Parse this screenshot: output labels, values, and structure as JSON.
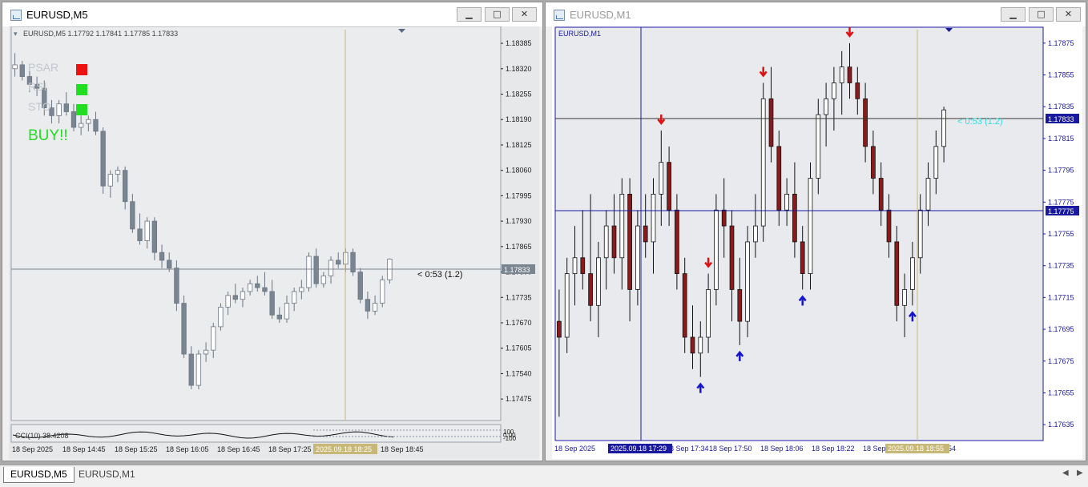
{
  "window_m5": {
    "title": "EURUSD,M5",
    "info_line": "EURUSD,M5  1.17792 1.17841 1.17785 1.17833",
    "indicator_labels": [
      "PSAR",
      "RSI",
      "STO"
    ],
    "signal_text": "BUY!!",
    "countdown": "< 0:53 (1.2)",
    "price_ticks": [
      "1.18385",
      "1.18320",
      "1.18255",
      "1.18190",
      "1.18125",
      "1.18060",
      "1.17995",
      "1.17930",
      "1.17865",
      "1.17800",
      "1.17735",
      "1.17670",
      "1.17605",
      "1.17540",
      "1.17475"
    ],
    "current_price": "1.17833",
    "time_ticks": [
      "18 Sep 2025",
      "18 Sep 14:45",
      "18 Sep 15:25",
      "18 Sep 16:05",
      "18 Sep 16:45",
      "18 Sep 17:25",
      "18 Sep 18:45"
    ],
    "cursor_time": "2025.09.18 18:25",
    "subwindow_label": "CCI(10) 38.4208",
    "subwindow_ticks": [
      "100",
      "0.00",
      "-100"
    ]
  },
  "window_m1": {
    "title": "EURUSD,M1",
    "info_line": "EURUSD,M1",
    "countdown": "< 0:53 (1.2)",
    "price_ticks": [
      "1.17875",
      "1.17855",
      "1.17835",
      "1.17815",
      "1.17795",
      "1.17775",
      "1.17755",
      "1.17735",
      "1.17715",
      "1.17695",
      "1.17675",
      "1.17655",
      "1.17635"
    ],
    "current_price": "1.17833",
    "crosshair_price": "1.17775",
    "time_ticks": [
      "18 Sep 2025",
      "18 Sep 17:34",
      "18 Sep 17:50",
      "18 Sep 18:06",
      "18 Sep 18:22",
      "18 Sep",
      "54"
    ],
    "crosshair_time": "2025.09.18 17:29",
    "cursor_time": "2025.09.18 18:55"
  },
  "window_buttons": {
    "minimize": "▁",
    "maximize": "□",
    "close": "✕"
  },
  "tabs": [
    "EURUSD,M5",
    "EURUSD,M1"
  ],
  "colors": {
    "bear_m5": "#7a8592",
    "bull_m5": "#ffffff",
    "axis_blue": "#1a1aa0",
    "buy_green": "#22dd22",
    "arrow_red": "#dd1111",
    "arrow_blue": "#1515d0",
    "cursor_tan": "#c8b878"
  },
  "chart_data": [
    {
      "type": "candlestick",
      "symbol": "EURUSD",
      "timeframe": "M5",
      "ylim": [
        1.1742,
        1.1842
      ],
      "candles": [
        [
          1.1832,
          1.1836,
          1.183,
          1.1833
        ],
        [
          1.1833,
          1.1834,
          1.1829,
          1.183
        ],
        [
          1.183,
          1.1832,
          1.1826,
          1.1828
        ],
        [
          1.1828,
          1.183,
          1.1825,
          1.1827
        ],
        [
          1.1827,
          1.1829,
          1.182,
          1.1822
        ],
        [
          1.1822,
          1.1824,
          1.1818,
          1.182
        ],
        [
          1.182,
          1.1824,
          1.1818,
          1.1823
        ],
        [
          1.1823,
          1.1826,
          1.182,
          1.1821
        ],
        [
          1.1821,
          1.1823,
          1.1816,
          1.1817
        ],
        [
          1.1817,
          1.182,
          1.1815,
          1.1818
        ],
        [
          1.1818,
          1.182,
          1.1816,
          1.1819
        ],
        [
          1.1819,
          1.1821,
          1.1815,
          1.1816
        ],
        [
          1.1816,
          1.1817,
          1.18,
          1.1802
        ],
        [
          1.1802,
          1.1806,
          1.1799,
          1.1805
        ],
        [
          1.1805,
          1.1807,
          1.1803,
          1.1806
        ],
        [
          1.1806,
          1.1807,
          1.1796,
          1.1798
        ],
        [
          1.1798,
          1.18,
          1.179,
          1.1791
        ],
        [
          1.1791,
          1.1795,
          1.1787,
          1.1788
        ],
        [
          1.1788,
          1.1794,
          1.1786,
          1.1793
        ],
        [
          1.1793,
          1.1794,
          1.1783,
          1.1785
        ],
        [
          1.1785,
          1.1787,
          1.1781,
          1.1783
        ],
        [
          1.1783,
          1.1785,
          1.178,
          1.1781
        ],
        [
          1.1781,
          1.1783,
          1.177,
          1.1772
        ],
        [
          1.1772,
          1.1774,
          1.1758,
          1.1759
        ],
        [
          1.1759,
          1.1761,
          1.175,
          1.1751
        ],
        [
          1.1751,
          1.176,
          1.175,
          1.1759
        ],
        [
          1.1759,
          1.1762,
          1.1757,
          1.176
        ],
        [
          1.176,
          1.1767,
          1.1758,
          1.1766
        ],
        [
          1.1766,
          1.1772,
          1.1765,
          1.1771
        ],
        [
          1.1771,
          1.1775,
          1.1769,
          1.1774
        ],
        [
          1.1774,
          1.1777,
          1.1772,
          1.1773
        ],
        [
          1.1773,
          1.1776,
          1.1771,
          1.1775
        ],
        [
          1.1775,
          1.1778,
          1.1774,
          1.1777
        ],
        [
          1.1777,
          1.1779,
          1.1775,
          1.1776
        ],
        [
          1.1776,
          1.178,
          1.1774,
          1.1775
        ],
        [
          1.1775,
          1.1778,
          1.1768,
          1.1769
        ],
        [
          1.1769,
          1.1771,
          1.1767,
          1.1768
        ],
        [
          1.1768,
          1.1774,
          1.1767,
          1.1772
        ],
        [
          1.1772,
          1.1776,
          1.177,
          1.1775
        ],
        [
          1.1775,
          1.1778,
          1.1773,
          1.1776
        ],
        [
          1.1776,
          1.1785,
          1.1775,
          1.1784
        ],
        [
          1.1784,
          1.1786,
          1.1776,
          1.1777
        ],
        [
          1.1777,
          1.178,
          1.1776,
          1.1779
        ],
        [
          1.1779,
          1.1784,
          1.1777,
          1.1783
        ],
        [
          1.1783,
          1.1785,
          1.1781,
          1.1782
        ],
        [
          1.1782,
          1.1786,
          1.178,
          1.1785
        ],
        [
          1.1785,
          1.1786,
          1.1779,
          1.178
        ],
        [
          1.178,
          1.1781,
          1.1772,
          1.1773
        ],
        [
          1.1773,
          1.1775,
          1.1768,
          1.177
        ],
        [
          1.177,
          1.1774,
          1.1769,
          1.1772
        ],
        [
          1.1772,
          1.1779,
          1.1771,
          1.1778
        ],
        [
          1.1778,
          1.17835,
          1.1777,
          1.17833
        ]
      ]
    },
    {
      "type": "candlestick",
      "symbol": "EURUSD",
      "timeframe": "M1",
      "ylim": [
        1.17625,
        1.17885
      ],
      "candles": [
        [
          1.177,
          1.1772,
          1.1764,
          1.1769
        ],
        [
          1.1769,
          1.1774,
          1.1768,
          1.1773
        ],
        [
          1.1773,
          1.1776,
          1.1771,
          1.1774
        ],
        [
          1.1774,
          1.1777,
          1.1772,
          1.1773
        ],
        [
          1.1773,
          1.1778,
          1.177,
          1.1771
        ],
        [
          1.1771,
          1.1775,
          1.1769,
          1.1774
        ],
        [
          1.1774,
          1.1777,
          1.1772,
          1.1776
        ],
        [
          1.1776,
          1.1778,
          1.1773,
          1.1774
        ],
        [
          1.1774,
          1.1779,
          1.1772,
          1.1778
        ],
        [
          1.1778,
          1.1779,
          1.177,
          1.1772
        ],
        [
          1.1772,
          1.1777,
          1.1771,
          1.1776
        ],
        [
          1.1776,
          1.1778,
          1.1774,
          1.1775
        ],
        [
          1.1775,
          1.1779,
          1.1773,
          1.1778
        ],
        [
          1.1778,
          1.1782,
          1.1776,
          1.178
        ],
        [
          1.178,
          1.1781,
          1.1776,
          1.1777
        ],
        [
          1.1777,
          1.1778,
          1.1772,
          1.1773
        ],
        [
          1.1773,
          1.1774,
          1.1768,
          1.1769
        ],
        [
          1.1769,
          1.1771,
          1.1767,
          1.1768
        ],
        [
          1.1768,
          1.177,
          1.17665,
          1.1769
        ],
        [
          1.1769,
          1.1773,
          1.1768,
          1.1772
        ],
        [
          1.1772,
          1.1778,
          1.1771,
          1.1777
        ],
        [
          1.1777,
          1.1779,
          1.1774,
          1.1776
        ],
        [
          1.1776,
          1.1777,
          1.177,
          1.1772
        ],
        [
          1.1772,
          1.1774,
          1.17685,
          1.177
        ],
        [
          1.177,
          1.1776,
          1.1769,
          1.1775
        ],
        [
          1.1775,
          1.1778,
          1.1774,
          1.1776
        ],
        [
          1.1776,
          1.1785,
          1.1775,
          1.1784
        ],
        [
          1.1784,
          1.1786,
          1.178,
          1.1781
        ],
        [
          1.1781,
          1.1782,
          1.1776,
          1.1777
        ],
        [
          1.1777,
          1.1779,
          1.1776,
          1.1778
        ],
        [
          1.1778,
          1.178,
          1.1774,
          1.1775
        ],
        [
          1.1775,
          1.1776,
          1.1772,
          1.1773
        ],
        [
          1.1773,
          1.178,
          1.1772,
          1.1779
        ],
        [
          1.1779,
          1.1784,
          1.1778,
          1.1783
        ],
        [
          1.1783,
          1.1785,
          1.1781,
          1.1784
        ],
        [
          1.1784,
          1.1786,
          1.1782,
          1.1785
        ],
        [
          1.1785,
          1.1787,
          1.1783,
          1.1786
        ],
        [
          1.1786,
          1.17875,
          1.1784,
          1.1785
        ],
        [
          1.1785,
          1.1786,
          1.1783,
          1.1784
        ],
        [
          1.1784,
          1.1785,
          1.178,
          1.1781
        ],
        [
          1.1781,
          1.1782,
          1.1778,
          1.1779
        ],
        [
          1.1779,
          1.178,
          1.1776,
          1.1777
        ],
        [
          1.1777,
          1.1778,
          1.1774,
          1.1775
        ],
        [
          1.1775,
          1.1776,
          1.177,
          1.1771
        ],
        [
          1.1771,
          1.1773,
          1.1769,
          1.1772
        ],
        [
          1.1772,
          1.1775,
          1.1771,
          1.1774
        ],
        [
          1.1774,
          1.1778,
          1.1773,
          1.1777
        ],
        [
          1.1777,
          1.178,
          1.1776,
          1.1779
        ],
        [
          1.1779,
          1.1782,
          1.1778,
          1.1781
        ],
        [
          1.1781,
          1.17835,
          1.178,
          1.17833
        ]
      ],
      "sell_signals": [
        "18 Sep 17:26",
        "18 Sep 17:37",
        "18 Sep 17:52",
        "18 Sep 18:14"
      ],
      "buy_signals": [
        "18 Sep 17:33",
        "18 Sep 17:40",
        "18 Sep 17:55",
        "18 Sep 18:19"
      ]
    }
  ]
}
